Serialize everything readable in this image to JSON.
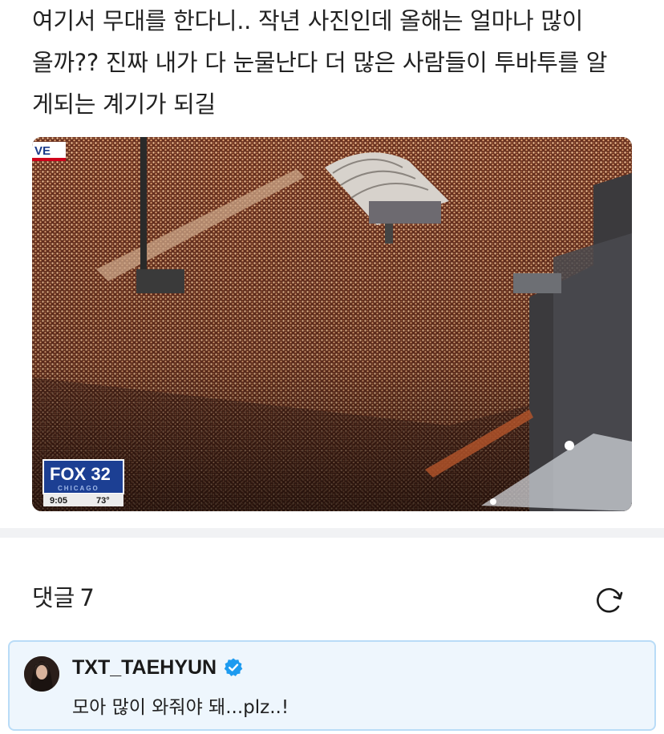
{
  "post": {
    "text": "여기서 무대를 한다니.. 작년 사진인데 올해는 얼마나 많이\n올까?? 진짜 내가 다 눈물난다 더 많은 사람들이 투바투를 알\n게되는 계기가 되길"
  },
  "photo": {
    "live_tag": "VE",
    "channel_logo": "FOX 32",
    "channel_city": "CHICAGO",
    "time": "9:05",
    "temperature": "73°"
  },
  "comments": {
    "label": "댓글",
    "count": "7",
    "refresh_icon": "refresh-icon"
  },
  "highlighted_comment": {
    "author": "TXT_TAEHYUN",
    "verified_icon": "verified-badge-icon",
    "text": "모아 많이 와줘야 돼...plz..!",
    "accent_color": "#1d9bf0"
  }
}
